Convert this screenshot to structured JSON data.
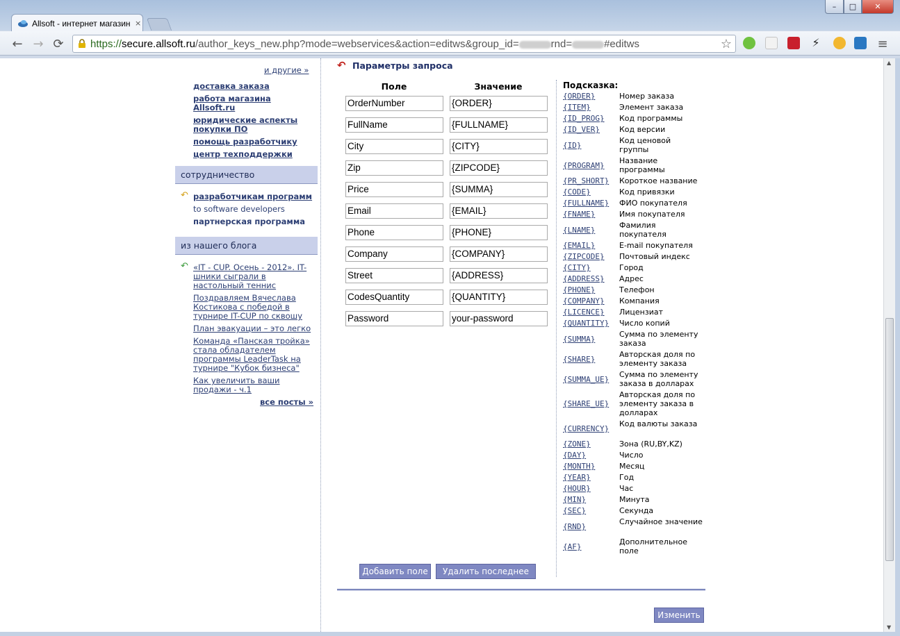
{
  "browser": {
    "tab_title": "Allsoft - интернет магазин",
    "tab_close": "×",
    "url_secure": "https://",
    "url_host": "secure.allsoft.ru",
    "url_path_a": "/author_keys_new.php?mode=webservices&action=editws&group_id=",
    "url_path_b": "rnd=",
    "url_path_c": "#editws",
    "back": "←",
    "forward": "→",
    "reload": "⟳",
    "star": "☆",
    "menu": "≡",
    "win_min": "–",
    "win_max": "□",
    "win_close": "✕"
  },
  "sidebar": {
    "more_vendors": "и другие »",
    "links": [
      "доставка заказа",
      "работа магазина Allsoft.ru",
      "юридические аспекты покупки ПО",
      "помощь разработчику",
      "центр техподдержки"
    ],
    "coop_header": "сотрудничество",
    "coop_links": [
      "разработчикам программ",
      "to software developers",
      "партнерская программа"
    ],
    "blog_header": "из нашего блога",
    "blog_posts": [
      "«IT - CUP. Осень - 2012». IT-шники сыграли в настольный теннис",
      "Поздравляем Вячеслава Костикова с победой в турнире IT-CUP по сквошу",
      "План эвакуации – это легко",
      "Команда «Панская тройка» стала обладателем программы LeaderTask на турнире \"Кубок бизнеса\"",
      "Как увеличить ваши продажи - ч.1"
    ],
    "all_posts": "все посты »"
  },
  "form": {
    "title": "Параметры запроса",
    "col_field": "Поле",
    "col_value": "Значение",
    "rows": [
      {
        "field": "OrderNumber",
        "value": "{ORDER}"
      },
      {
        "field": "FullName",
        "value": "{FULLNAME}"
      },
      {
        "field": "City",
        "value": "{CITY}"
      },
      {
        "field": "Zip",
        "value": "{ZIPCODE}"
      },
      {
        "field": "Price",
        "value": "{SUMMA}"
      },
      {
        "field": "Email",
        "value": "{EMAIL}"
      },
      {
        "field": "Phone",
        "value": "{PHONE}"
      },
      {
        "field": "Company",
        "value": "{COMPANY}"
      },
      {
        "field": "Street",
        "value": "{ADDRESS}"
      },
      {
        "field": "CodesQuantity",
        "value": "{QUANTITY}"
      },
      {
        "field": "Password",
        "value": "your-password"
      }
    ],
    "add_button": "Добавить поле",
    "remove_button": "Удалить последнее",
    "submit_button": "Изменить"
  },
  "hints": {
    "title": "Подсказка:",
    "items": [
      {
        "code": "{ORDER}",
        "desc": "Номер заказа"
      },
      {
        "code": "{ITEM}",
        "desc": "Элемент заказа"
      },
      {
        "code": "{ID_PROG}",
        "desc": "Код программы"
      },
      {
        "code": "{ID_VER}",
        "desc": "Код версии"
      },
      {
        "code": "{ID}",
        "desc": "Код ценовой группы"
      },
      {
        "code": "{PROGRAM}",
        "desc": "Название программы"
      },
      {
        "code": "{PR_SHORT}",
        "desc": "Короткое название"
      },
      {
        "code": "{CODE}",
        "desc": "Код привязки"
      },
      {
        "code": "{FULLNAME}",
        "desc": "ФИО покупателя"
      },
      {
        "code": "{FNAME}",
        "desc": "Имя покупателя"
      },
      {
        "code": "{LNAME}",
        "desc": "Фамилия покупателя"
      },
      {
        "code": "{EMAIL}",
        "desc": "E-mail покупателя"
      },
      {
        "code": "{ZIPCODE}",
        "desc": "Почтовый индекс"
      },
      {
        "code": "{CITY}",
        "desc": "Город"
      },
      {
        "code": "{ADDRESS}",
        "desc": "Адрес"
      },
      {
        "code": "{PHONE}",
        "desc": "Телефон"
      },
      {
        "code": "{COMPANY}",
        "desc": "Компания"
      },
      {
        "code": "{LICENCE}",
        "desc": "Лицензиат"
      },
      {
        "code": "{QUANTITY}",
        "desc": "Число копий"
      },
      {
        "code": "{SUMMA}",
        "desc": "Сумма по элементу заказа"
      },
      {
        "code": "{SHARE}",
        "desc": "Авторская доля по элементу заказа"
      },
      {
        "code": "{SUMMA_UE}",
        "desc": "Сумма по элементу заказа в долларах"
      },
      {
        "code": "{SHARE_UE}",
        "desc": "Авторская доля по элементу заказа в долларах"
      },
      {
        "code": "{CURRENCY}",
        "desc": "Код валюты заказа"
      },
      {
        "code": "{ZONE}",
        "desc": "Зона (RU,BY,KZ)"
      },
      {
        "code": "{DAY}",
        "desc": "Число"
      },
      {
        "code": "{MONTH}",
        "desc": "Месяц"
      },
      {
        "code": "{YEAR}",
        "desc": "Год"
      },
      {
        "code": "{HOUR}",
        "desc": "Час"
      },
      {
        "code": "{MIN}",
        "desc": "Минута"
      },
      {
        "code": "{SEC}",
        "desc": "Секунда"
      },
      {
        "code": "{RND}",
        "desc": "Случайное значение"
      },
      {
        "code": "{AF}",
        "desc": "Дополнительное поле"
      }
    ]
  },
  "colors": {
    "link": "#2d3f74",
    "section_header_bg": "#c9d0ea",
    "button_bg": "#7f88c2",
    "title_arrow": "#c0201b"
  }
}
